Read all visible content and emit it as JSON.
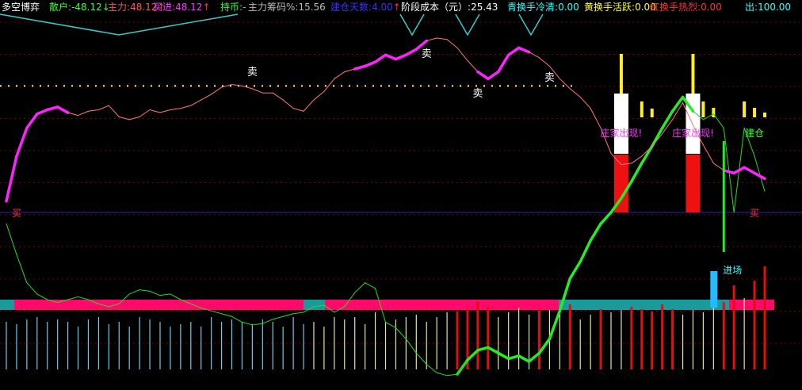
{
  "header": {
    "title": "多空博弈",
    "items": [
      {
        "label": "散户",
        "value": "-48.12",
        "arrow": "↓",
        "color": "#33ff33"
      },
      {
        "label": "主力",
        "value": "48.12",
        "arrow": "↑",
        "color": "#ff5555"
      },
      {
        "label": "买进",
        "value": "48.12",
        "arrow": "↑",
        "color": "#ff33ff"
      },
      {
        "label": "持币",
        "value": "-",
        "arrow": "",
        "color": "#33ff33"
      },
      {
        "label": "主力筹码%",
        "value": "15.56",
        "arrow": "",
        "color": "#bbbbbb"
      },
      {
        "label": "建仓天数",
        "value": "4.00",
        "arrow": "↑",
        "color": "#3333ff"
      },
      {
        "label": "阶段成本（元）",
        "value": "25.43",
        "arrow": "",
        "color": "#ffffff"
      },
      {
        "label": "青换手冷清",
        "value": "0.00",
        "arrow": "",
        "color": "#33ffff"
      },
      {
        "label": "黄换手活跃",
        "value": "0.00",
        "arrow": "",
        "color": "#ffff33"
      },
      {
        "label": "红换手热烈",
        "value": "0.00",
        "arrow": "",
        "color": "#ff3333"
      },
      {
        "label": "出",
        "value": "100.00",
        "arrow": "",
        "color": "#33ffff"
      }
    ]
  },
  "chart_data": {
    "type": "line",
    "sell_marks": [
      {
        "text": "卖",
        "i": 24
      },
      {
        "text": "卖",
        "i": 41
      },
      {
        "text": "卖",
        "i": 46
      },
      {
        "text": "卖",
        "i": 53
      }
    ],
    "buy_marks": [
      {
        "text": "买",
        "i": 1
      },
      {
        "text": "买",
        "i": 73
      }
    ],
    "banner_zhuangjia": [
      {
        "text": "庄家出现!",
        "i": 60
      },
      {
        "text": "庄家出现!",
        "i": 67
      }
    ],
    "jiancang": {
      "text": "建仓",
      "i": 73
    },
    "jinchang": {
      "text": "进场",
      "i": 71
    },
    "series": [
      {
        "key": "main_line",
        "values": [
          8,
          40,
          60,
          70,
          73,
          75,
          71,
          69,
          72,
          73,
          76,
          68,
          66,
          68,
          73,
          71,
          73,
          74,
          76,
          80,
          84,
          89,
          91,
          90,
          88,
          85,
          85,
          80,
          74,
          72,
          80,
          86,
          95,
          100,
          102,
          104,
          107,
          112,
          109,
          112,
          116,
          122,
          124,
          123,
          117,
          108,
          100,
          95,
          100,
          112,
          117,
          114,
          110,
          104,
          95,
          88,
          82,
          74,
          60,
          42,
          34,
          35,
          40,
          47,
          56,
          66,
          78,
          62,
          48,
          35,
          30,
          28,
          32,
          28,
          24
        ]
      },
      {
        "key": "secondary_line",
        "values": [
          -8,
          -30,
          -50,
          -58,
          -62,
          -64,
          -62,
          -60,
          -62,
          -65,
          -67,
          -65,
          -58,
          -55,
          -56,
          -59,
          -58,
          -62,
          -65,
          -68,
          -70,
          -72,
          -74,
          -78,
          -80,
          -79,
          -76,
          -74,
          -72,
          -71,
          -67,
          -66,
          -71,
          -67,
          -57,
          -50,
          -54,
          -78,
          -82,
          -90,
          -100,
          -108,
          -114,
          -116,
          -115,
          -105,
          -98,
          -96,
          -100,
          -104,
          -102,
          -106,
          -100,
          -90,
          -70,
          -47,
          -35,
          -20,
          -8,
          0,
          10,
          22,
          35,
          47,
          60,
          72,
          82,
          72,
          66,
          70,
          60,
          0,
          60,
          40,
          15
        ]
      },
      {
        "key": "base_line",
        "values": [
          0,
          0
        ]
      },
      {
        "key": "dotted_level",
        "values": [
          90,
          90
        ]
      },
      {
        "key": "volume_bars",
        "values": [
          20,
          19,
          21,
          22,
          20,
          21,
          20,
          18,
          21,
          22,
          19,
          20,
          18,
          22,
          21,
          20,
          18,
          19,
          20,
          18,
          22,
          20,
          21,
          20,
          19,
          21,
          20,
          18,
          22,
          19,
          20,
          18,
          22,
          21,
          22,
          19,
          24,
          20,
          21,
          22,
          23,
          20,
          22,
          24,
          21,
          22,
          25,
          23,
          22,
          24,
          26,
          23,
          22,
          25,
          23,
          24,
          21,
          23,
          22,
          24,
          25,
          23,
          22,
          21,
          24,
          22,
          23,
          25,
          24,
          26,
          25,
          32,
          30,
          34,
          40
        ]
      }
    ]
  }
}
